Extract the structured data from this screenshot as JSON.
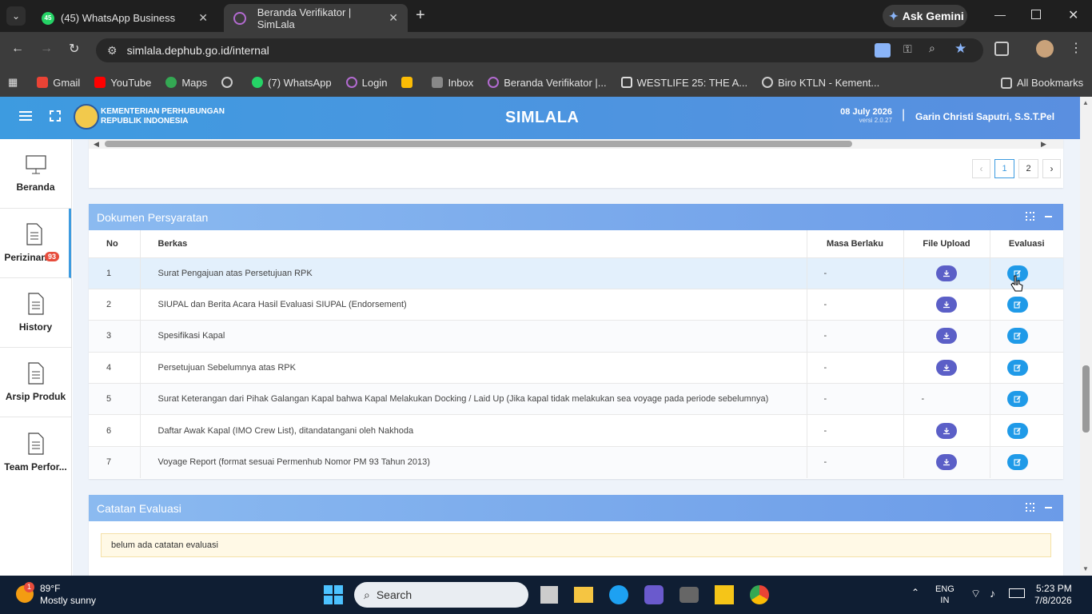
{
  "browser": {
    "tabs": [
      {
        "label": "(45) WhatsApp Business",
        "badge": "45"
      },
      {
        "label": "Beranda Verifikator | SimLala"
      }
    ],
    "new_tab": "+",
    "ask_gemini": "Ask Gemini",
    "url": "simlala.dephub.go.id/internal",
    "bookmarks": [
      "Gmail",
      "YouTube",
      "Maps",
      "",
      "(7) WhatsApp",
      "Login",
      "",
      "Inbox",
      "Beranda Verifikator |...",
      "WESTLIFE 25: THE A...",
      "Biro KTLN - Kement..."
    ],
    "all_bookmarks": "All Bookmarks"
  },
  "header": {
    "org_line1": "KEMENTERIAN PERHUBUNGAN",
    "org_line2": "REPUBLIK INDONESIA",
    "app_title": "SIMLALA",
    "date": "08 July 2026",
    "version": "versi 2.0.27",
    "separator": "|",
    "user": "Garin Christi Saputri, S.S.T.Pel"
  },
  "sidebar": {
    "items": [
      {
        "label": "Beranda",
        "icon": "monitor-icon"
      },
      {
        "label": "Perizinan",
        "icon": "document-icon",
        "badge": "93"
      },
      {
        "label": "History",
        "icon": "document-icon"
      },
      {
        "label": "Arsip Produk",
        "icon": "document-icon"
      },
      {
        "label": "Team Perfor...",
        "icon": "document-icon"
      }
    ]
  },
  "pagination": {
    "prev": "‹",
    "pages": [
      "1",
      "2"
    ],
    "next": "›",
    "current": "1"
  },
  "dokumen": {
    "title": "Dokumen Persyaratan",
    "columns": [
      "No",
      "Berkas",
      "Masa Berlaku",
      "File Upload",
      "Evaluasi"
    ],
    "rows": [
      {
        "no": "1",
        "berkas": "Surat Pengajuan atas Persetujuan RPK",
        "masa": "-",
        "upload": "download",
        "highlight": true
      },
      {
        "no": "2",
        "berkas": "SIUPAL dan Berita Acara Hasil Evaluasi SIUPAL (Endorsement)",
        "masa": "-",
        "upload": "download"
      },
      {
        "no": "3",
        "berkas": "Spesifikasi Kapal",
        "masa": "-",
        "upload": "download"
      },
      {
        "no": "4",
        "berkas": "Persetujuan Sebelumnya atas RPK",
        "masa": "-",
        "upload": "download"
      },
      {
        "no": "5",
        "berkas": "Surat Keterangan dari Pihak Galangan Kapal bahwa Kapal Melakukan Docking / Laid Up (Jika kapal tidak melakukan sea voyage pada periode sebelumnya)",
        "masa": "-",
        "upload": "-"
      },
      {
        "no": "6",
        "berkas": "Daftar Awak Kapal (IMO Crew List), ditandatangani oleh Nakhoda",
        "masa": "-",
        "upload": "download"
      },
      {
        "no": "7",
        "berkas": "Voyage Report (format sesuai Permenhub Nomor PM 93 Tahun 2013)",
        "masa": "-",
        "upload": "download"
      }
    ]
  },
  "catatan": {
    "title": "Catatan Evaluasi",
    "text": "belum ada catatan evaluasi"
  },
  "taskbar": {
    "weather_temp": "89°F",
    "weather_desc": "Mostly sunny",
    "weather_badge": "1",
    "search": "Search",
    "lang1": "ENG",
    "lang2": "IN",
    "time": "5:23 PM",
    "date": "7/8/2026"
  },
  "colors": {
    "header": "#3d9be0",
    "card_head": "#7aa9ec",
    "download_btn": "#5b5fc7",
    "edit_btn": "#1f9ae8",
    "note_bg": "#fff9e6"
  }
}
